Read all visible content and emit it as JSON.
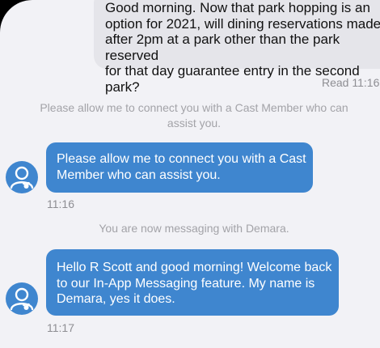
{
  "outgoing": {
    "text": "Good morning. Now that park hopping is an\noption for 2021, will dining reservations made\nafter 2pm at a park other than the park reserved\nfor that day guarantee entry in the second park?",
    "read_receipt": "Read 11:16"
  },
  "system_messages": [
    "Please allow me to connect you with a Cast Member who can assist you.",
    "You are now messaging with Demara."
  ],
  "incoming": [
    {
      "text": "Please allow me to connect you with a Cast\nMember who can assist you.",
      "time": "11:16",
      "avatar_icon": "mickey-user-icon"
    },
    {
      "text": "Hello R Scott and good morning! Welcome back\nto our In-App Messaging feature. My name is\nDemara, yes it does.",
      "time": "11:17",
      "avatar_icon": "mickey-user-icon"
    }
  ],
  "colors": {
    "background": "#f2f2f6",
    "outgoing_bubble": "#e5e5ea",
    "incoming_bubble": "#3f86cf",
    "meta_text": "#8e8e93",
    "system_text": "#a3a3a8"
  }
}
